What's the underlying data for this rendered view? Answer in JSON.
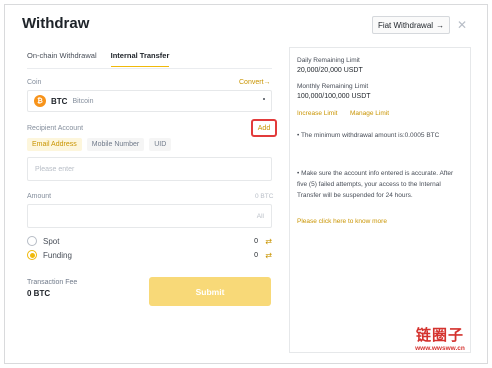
{
  "dialog": {
    "title": "Withdraw",
    "fiat_button_label": "Fiat Withdrawal",
    "fiat_arrow": "→",
    "close_glyph": "✕"
  },
  "tabs": [
    {
      "label": "On-chain Withdrawal",
      "active": false
    },
    {
      "label": "Internal Transfer",
      "active": true
    }
  ],
  "coin": {
    "label": "Coin",
    "convert_label": "Convert→",
    "icon_glyph": "₿",
    "symbol": "BTC",
    "name": "Bitcoin"
  },
  "recipient": {
    "label": "Recipient Account",
    "add_label": "Add",
    "chips": [
      "Email Address",
      "Mobile Number",
      "UID"
    ],
    "placeholder": "Please enter"
  },
  "amount": {
    "label": "Amount",
    "balance": "0 BTC",
    "suffix": "All"
  },
  "wallets": [
    {
      "label": "Spot",
      "value": "0",
      "checked": false
    },
    {
      "label": "Funding",
      "value": "0",
      "checked": true
    }
  ],
  "swap_glyph": "⇄",
  "fee": {
    "label": "Transaction Fee",
    "value": "0 BTC"
  },
  "submit_label": "Submit",
  "side_panel": {
    "daily_label": "Daily Remaining Limit",
    "daily_value": "20,000/20,000 USDT",
    "monthly_label": "Monthly Remaining Limit",
    "monthly_value": "100,000/100,000 USDT",
    "increase_label": "Increase Limit",
    "manage_label": "Manage Limit",
    "min_note": "• The minimum withdrawal amount is:0.0005 BTC",
    "security_note": "• Make sure the account info entered is accurate. After five (5) failed attempts, your access to the Internal Transfer will be suspended for 24 hours.",
    "know_more": "Please click here to know more"
  },
  "watermark": {
    "cn": "链圈子",
    "url": "www.wwsww.cn"
  },
  "colors": {
    "accent": "#f0b90b",
    "link": "#c99400",
    "highlight_box": "#e23b3b",
    "submit_disabled": "#f8d978"
  }
}
